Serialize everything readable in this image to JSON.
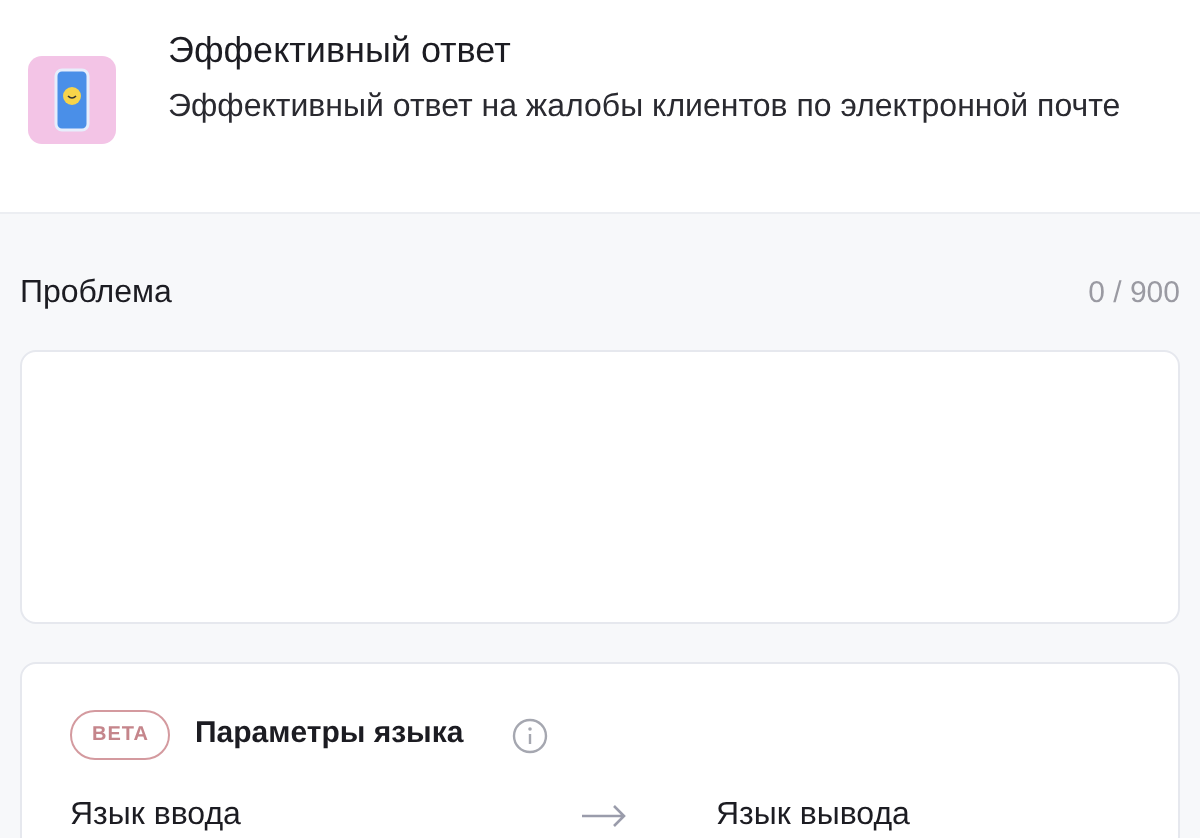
{
  "header": {
    "title": "Эффективный ответ",
    "description": "Эффективный ответ на жалобы клиентов по электронной почте"
  },
  "problem": {
    "label": "Проблема",
    "counter": "0 / 900"
  },
  "language": {
    "badge": "BETA",
    "title": "Параметры языка",
    "input_label": "Язык ввода",
    "output_label": "Язык вывода"
  }
}
